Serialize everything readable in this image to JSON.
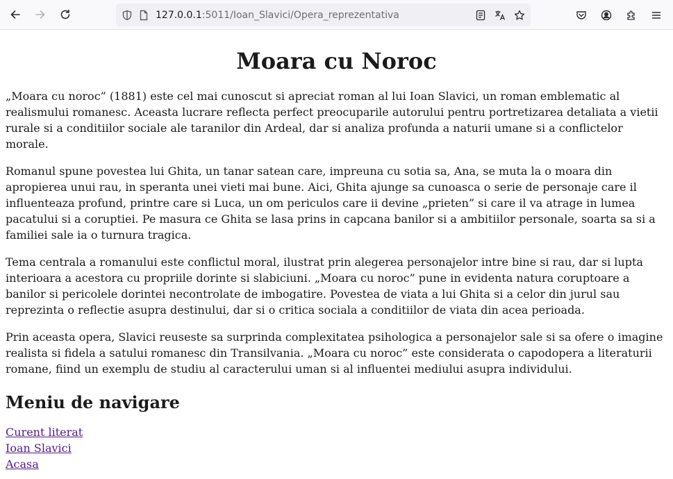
{
  "browser": {
    "url_host": "127.0.0.1",
    "url_rest": ":5011/Ioan_Slavici/Opera_reprezentativa"
  },
  "page": {
    "title": "Moara cu Noroc",
    "paragraphs": [
      "„Moara cu noroc” (1881) este cel mai cunoscut si apreciat roman al lui Ioan Slavici, un roman emblematic al realismului romanesc. Aceasta lucrare reflecta perfect preocuparile autorului pentru portretizarea detaliata a vietii rurale si a conditiilor sociale ale taranilor din Ardeal, dar si analiza profunda a naturii umane si a conflictelor morale.",
      "Romanul spune povestea lui Ghita, un tanar satean care, impreuna cu sotia sa, Ana, se muta la o moara din apropierea unui rau, in speranta unei vieti mai bune. Aici, Ghita ajunge sa cunoasca o serie de personaje care il influenteaza profund, printre care si Luca, un om periculos care ii devine „prieten” si care il va atrage in lumea pacatului si a coruptiei. Pe masura ce Ghita se lasa prins in capcana banilor si a ambitiilor personale, soarta sa si a familiei sale ia o turnura tragica.",
      "Tema centrala a romanului este conflictul moral, ilustrat prin alegerea personajelor intre bine si rau, dar si lupta interioara a acestora cu propriile dorinte si slabiciuni. „Moara cu noroc” pune in evidenta natura coruptoare a banilor si pericolele dorintei necontrolate de imbogatire. Povestea de viata a lui Ghita si a celor din jurul sau reprezinta o reflectie asupra destinului, dar si o critica sociala a conditiilor de viata din acea perioada.",
      "Prin aceasta opera, Slavici reuseste sa surprinda complexitatea psihologica a personajelor sale si sa ofere o imagine realista si fidela a satului romanesc din Transilvania. „Moara cu noroc” este considerata o capodopera a literaturii romane, fiind un exemplu de studiu al caracterului uman si al influentei mediului asupra individului."
    ],
    "nav_heading": "Meniu de navigare",
    "nav_links": [
      "Curent literat",
      "Ioan Slavici",
      "Acasa"
    ]
  },
  "colors": {
    "link_visited": "#551a8b"
  },
  "icons": [
    "back-arrow-icon",
    "forward-arrow-icon",
    "reload-icon",
    "shield-icon",
    "page-icon",
    "reader-view-icon",
    "translate-icon",
    "bookmark-star-icon",
    "pocket-icon",
    "account-icon",
    "extensions-icon",
    "menu-icon"
  ]
}
